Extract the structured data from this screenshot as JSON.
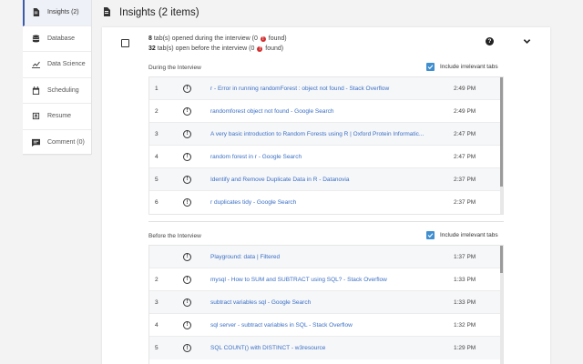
{
  "sidebar": {
    "items": [
      {
        "label": "Insights (2)",
        "icon": "document-icon",
        "active": true
      },
      {
        "label": "Database",
        "icon": "database-icon"
      },
      {
        "label": "Data Science",
        "icon": "chart-icon"
      },
      {
        "label": "Scheduling",
        "icon": "calendar-icon"
      },
      {
        "label": "Resume",
        "icon": "resume-icon"
      },
      {
        "label": "Comment (0)",
        "icon": "comment-icon"
      }
    ]
  },
  "header": {
    "title": "Insights (2 items)",
    "icon": "document-icon"
  },
  "summary": {
    "line1_count": "8",
    "line1_text": " tab(s) opened during the interview (",
    "line1_found": "0",
    "line1_end": " found)",
    "line2_count": "32",
    "line2_text": " tab(s) open before the interview (",
    "line2_found": "0",
    "line2_end": " found)",
    "red_mark": "!"
  },
  "during": {
    "label": "During the Interview",
    "include_label": "Include irrelevant tabs",
    "include_checked": true,
    "rows": [
      {
        "num": "1",
        "title": "r - Error in running randomForest : object not found - Stack Overflow",
        "time": "2:49 PM"
      },
      {
        "num": "2",
        "title": "randomforest object not found - Google Search",
        "time": "2:49 PM"
      },
      {
        "num": "3",
        "title": "A very basic introduction to Random Forests using R | Oxford Protein Informatic...",
        "time": "2:47 PM"
      },
      {
        "num": "4",
        "title": "random forest in r - Google Search",
        "time": "2:47 PM"
      },
      {
        "num": "5",
        "title": "Identify and Remove Duplicate Data in R - Datanovia",
        "time": "2:37 PM"
      },
      {
        "num": "6",
        "title": "r duplicates tidy - Google Search",
        "time": "2:37 PM"
      }
    ]
  },
  "before": {
    "label": "Before the Interview",
    "include_label": "Include irrelevant tabs",
    "include_checked": true,
    "rows": [
      {
        "num": "",
        "title": "Playground: data | Filtered",
        "time": "1:37 PM"
      },
      {
        "num": "2",
        "title": "mysql - How to SUM and SUBTRACT using SQL? - Stack Overflow",
        "time": "1:33 PM"
      },
      {
        "num": "3",
        "title": "subtract variables sql - Google Search",
        "time": "1:33 PM"
      },
      {
        "num": "4",
        "title": "sql server - subtract variables in SQL - Stack Overflow",
        "time": "1:32 PM"
      },
      {
        "num": "5",
        "title": "SQL COUNT() with DISTINCT - w3resource",
        "time": "1:29 PM"
      }
    ]
  },
  "row_icon": "!"
}
